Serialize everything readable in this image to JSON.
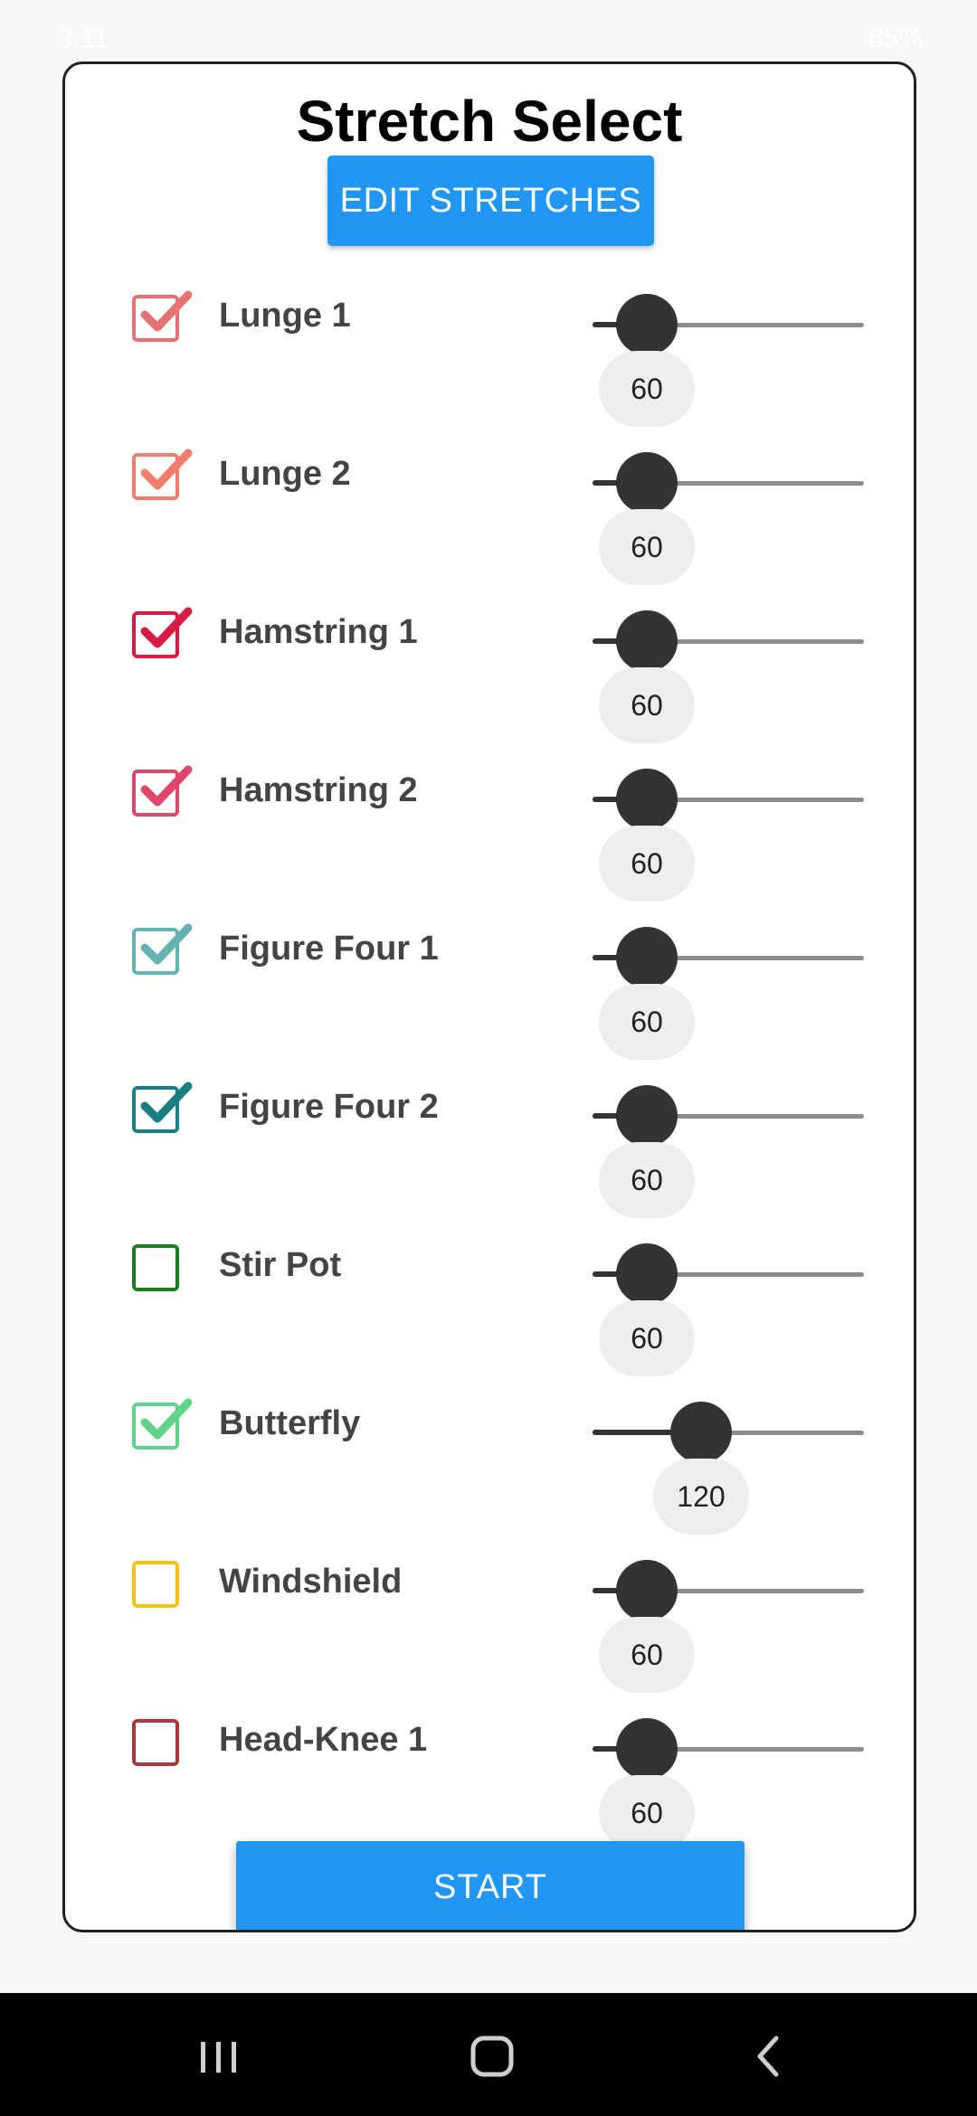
{
  "status_bar": {
    "time": "3:11",
    "battery": "85%"
  },
  "title": "Stretch Select",
  "edit_button_label": "EDIT STRETCHES",
  "start_button_label": "START",
  "slider": {
    "min": 0,
    "max": 300
  },
  "stretches": [
    {
      "label": "Lunge 1",
      "checked": true,
      "color": "#e57373",
      "value": "60"
    },
    {
      "label": "Lunge 2",
      "checked": true,
      "color": "#ef7f6a",
      "value": "60"
    },
    {
      "label": "Hamstring 1",
      "checked": true,
      "color": "#d81b42",
      "value": "60"
    },
    {
      "label": "Hamstring 2",
      "checked": true,
      "color": "#e0456b",
      "value": "60"
    },
    {
      "label": "Figure Four 1",
      "checked": true,
      "color": "#66b2b2",
      "value": "60"
    },
    {
      "label": "Figure Four 2",
      "checked": true,
      "color": "#1a7f7f",
      "value": "60"
    },
    {
      "label": "Stir Pot",
      "checked": false,
      "color": "#1e7b1e",
      "value": "60"
    },
    {
      "label": "Butterfly",
      "checked": true,
      "color": "#5fd38a",
      "value": "120"
    },
    {
      "label": "Windshield",
      "checked": false,
      "color": "#f2c218",
      "value": "60"
    },
    {
      "label": "Head-Knee 1",
      "checked": false,
      "color": "#a63a3a",
      "value": "60"
    }
  ],
  "nav": {
    "recents_icon": "recents-icon",
    "home_icon": "home-icon",
    "back_icon": "back-icon"
  }
}
